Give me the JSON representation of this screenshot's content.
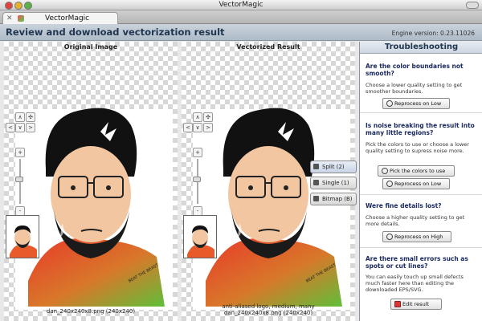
{
  "window": {
    "title": "VectorMagic"
  },
  "tab": {
    "title": "VectorMagic",
    "close": "✕"
  },
  "header": {
    "title": "Review and download vectorization result",
    "engine_version": "Engine version: 0.23.11026"
  },
  "panes": {
    "original": {
      "title": "Original Image",
      "caption_line1": "dan_240x240x8.png (240x240)"
    },
    "vectorized": {
      "title": "Vectorized Result",
      "caption_line1": "anti-aliased logo, medium, many",
      "caption_line2": "dan_240x240x8.png (240x240)"
    }
  },
  "controls": {
    "up": "∧",
    "down": "∨",
    "left": "<",
    "right": ">",
    "fit": "✣",
    "zoom_in": "+",
    "zoom_out": "-"
  },
  "modes": [
    {
      "label": "Split (2)"
    },
    {
      "label": "Single (1)"
    },
    {
      "label": "Bitmap (B)"
    }
  ],
  "sidebar": {
    "title": "Troubleshooting",
    "sections": [
      {
        "question": "Are the color boundaries not smooth?",
        "description": "Choose a lower quality setting to get smoother boundaries.",
        "buttons": [
          "Reprocess on Low"
        ]
      },
      {
        "question": "Is noise breaking the result into many little regions?",
        "description": "Pick the colors to use or choose a lower quality setting to supress noise more.",
        "buttons": [
          "Pick the colors to use",
          "Reprocess on Low"
        ]
      },
      {
        "question": "Were fine details lost?",
        "description": "Choose a higher quality setting to get more details.",
        "buttons": [
          "Reprocess on High"
        ]
      },
      {
        "question": "Are there small errors such as spots or cut lines?",
        "description": "You can easily touch up small defects much faster here than editing the downloaded EPS/SVG.",
        "buttons": [
          "Edit result"
        ]
      }
    ]
  }
}
